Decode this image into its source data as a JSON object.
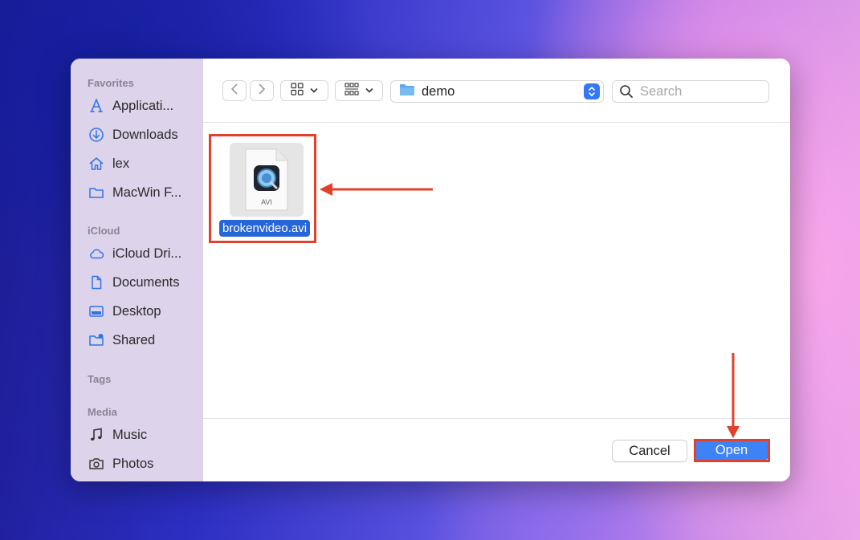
{
  "sidebar": {
    "sections": {
      "favorites": "Favorites",
      "icloud": "iCloud",
      "tags": "Tags",
      "media": "Media"
    },
    "favorites": [
      {
        "label": "Applicati...",
        "icon": "applications-icon"
      },
      {
        "label": "Downloads",
        "icon": "downloads-icon"
      },
      {
        "label": "lex",
        "icon": "home-icon"
      },
      {
        "label": "MacWin F...",
        "icon": "folder-icon"
      }
    ],
    "icloud": [
      {
        "label": "iCloud Dri...",
        "icon": "cloud-icon"
      },
      {
        "label": "Documents",
        "icon": "document-icon"
      },
      {
        "label": "Desktop",
        "icon": "desktop-icon"
      },
      {
        "label": "Shared",
        "icon": "shared-folder-icon"
      }
    ],
    "media": [
      {
        "label": "Music",
        "icon": "music-note-icon"
      },
      {
        "label": "Photos",
        "icon": "camera-icon"
      }
    ]
  },
  "toolbar": {
    "path": "demo",
    "search_placeholder": "Search"
  },
  "file": {
    "name": "brokenvideo.avi",
    "type_label": "AVI"
  },
  "footer": {
    "cancel_label": "Cancel",
    "open_label": "Open"
  },
  "colors": {
    "accent": "#3e82f7",
    "selection": "#2766d8",
    "annotation": "#e1402a",
    "sidebar_bg": "#ddd3ea"
  }
}
